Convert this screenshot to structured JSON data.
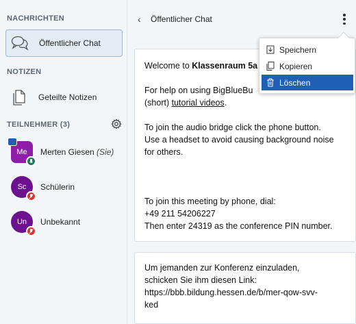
{
  "sidebar": {
    "messages_title": "NACHRICHTEN",
    "public_chat_label": "Öffentlicher Chat",
    "notes_title": "NOTIZEN",
    "shared_notes_label": "Geteilte Notizen",
    "participants_title": "TEILNEHMER (3)"
  },
  "users": [
    {
      "initials": "Me",
      "name": "Merten Giesen",
      "suffix": "(Sie)",
      "color": "#8e1ea9"
    },
    {
      "initials": "Sc",
      "name": "Schülerin",
      "suffix": "",
      "color": "#6c1290"
    },
    {
      "initials": "Un",
      "name": "Unbekannt",
      "suffix": "",
      "color": "#6c1290"
    }
  ],
  "chat": {
    "title": "Öffentlicher Chat",
    "welcome": {
      "line1_prefix": "Welcome to ",
      "line1_bold": "Klassenraum 5a",
      "line2": "For help on using BigBlueBu",
      "line3_prefix": "(short) ",
      "line3_link": "tutorial videos",
      "line3_suffix": ".",
      "line4": "To join the audio bridge click the phone button.",
      "line5": "Use a headset to avoid causing background noise",
      "line6": "for others.",
      "line7": "To join this meeting by phone, dial:",
      "line8": "+49 211 54206227",
      "line9": "Then enter 24319 as the conference PIN number."
    },
    "invite": {
      "line1": "Um jemanden zur Konferenz einzuladen,",
      "line2": "schicken Sie ihm diesen Link:",
      "line3": "https://bbb.bildung.hessen.de/b/mer-qow-svv-",
      "line4": "ked"
    }
  },
  "menu": {
    "items": [
      "Speichern",
      "Kopieren",
      "Löschen"
    ]
  },
  "colors": {
    "accent": "#1f5fb5",
    "mic_badge": "#1b7a5a",
    "muted_badge": "#d9352c"
  }
}
